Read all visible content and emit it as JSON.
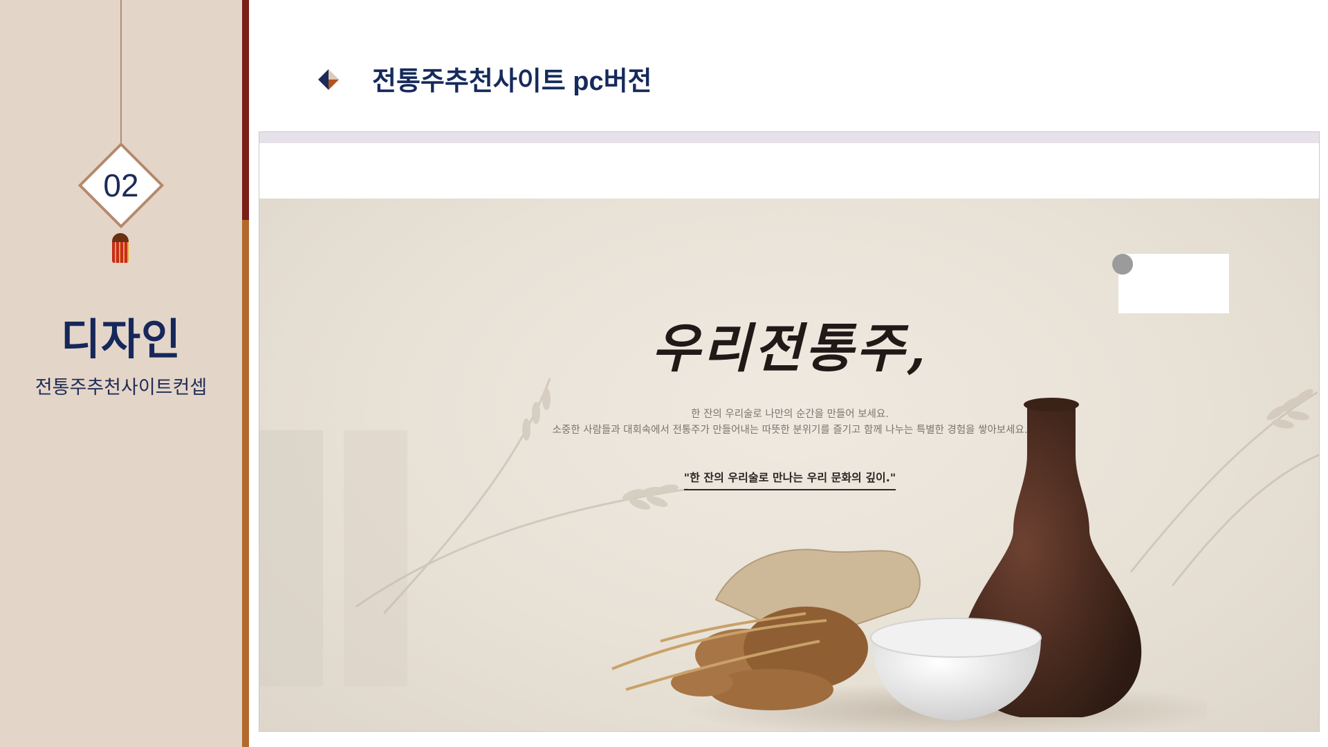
{
  "sidebar": {
    "section_number": "02",
    "section_title": "디자인",
    "section_subtitle": "전통주추천사이트컨셉"
  },
  "header": {
    "title": "전통주추천사이트 pc버전",
    "icon": "diamond-bullet-icon"
  },
  "screenshot": {
    "calligraphy_title": "우리전통주,",
    "intro_line1": "한 잔의 우리술로 나만의 순간을 만들어 보세요.",
    "intro_line2": "소중한 사람들과 대회속에서 전통주가 만들어내는 따뜻한 분위기를 즐기고 함께 나누는 특별한 경험을 쌓아보세요.",
    "quote": "\"한 잔의 우리술로 만나는 우리 문화의 깊이.\""
  },
  "colors": {
    "sidebar_bg": "#e4d5c9",
    "navy": "#16285a",
    "accent_dark_red": "#7a1e16",
    "accent_brown": "#b26a2c",
    "jar_brown": "#4a2b1f"
  }
}
